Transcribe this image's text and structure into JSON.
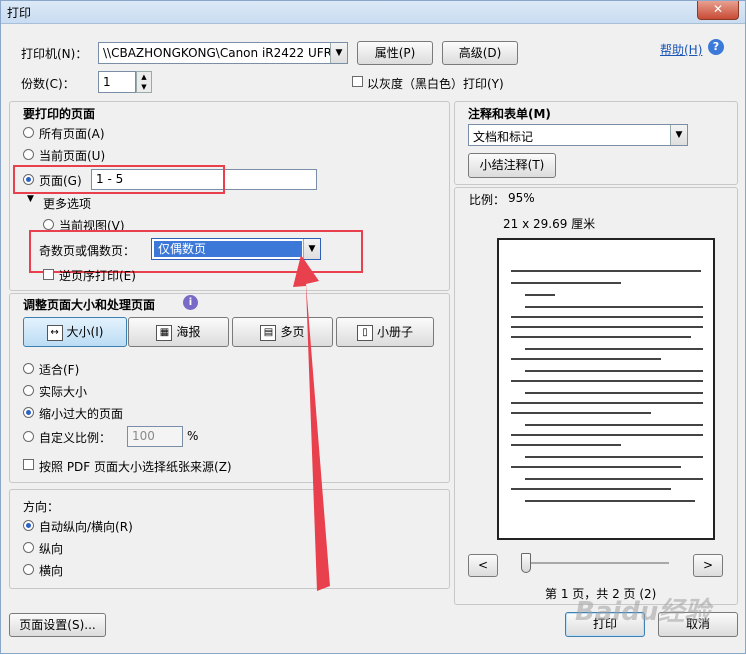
{
  "window": {
    "title": "打印",
    "close_glyph": "✕"
  },
  "printer": {
    "label": "打印机(N)：",
    "selected": "\\\\CBAZHONGKONG\\Canon iR2422 UFRII LT",
    "properties_button": "属性(P)",
    "advanced_button": "高级(D)",
    "help_link": "帮助(H)",
    "help_icon": "?"
  },
  "copies": {
    "label": "份数(C)：",
    "value": "1",
    "grayscale_label": "以灰度（黑白色）打印(Y)"
  },
  "pages_to_print": {
    "heading": "要打印的页面",
    "all_pages": "所有页面(A)",
    "current_page": "当前页面(U)",
    "pages": "页面(G)",
    "pages_value": "1 - 5",
    "more_options": "更多选项",
    "current_view": "当前视图(V)",
    "odd_even_label": "奇数页或偶数页：",
    "odd_even_selected": "仅偶数页",
    "reverse_order": "逆页序打印(E)"
  },
  "page_sizing": {
    "heading": "调整页面大小和处理页面",
    "info_icon": "i",
    "size_button": "大小(I)",
    "poster_button": "海报",
    "multiple_button": "多页",
    "booklet_button": "小册子",
    "fit": "适合(F)",
    "actual_size": "实际大小",
    "shrink_oversized": "缩小过大的页面",
    "custom_scale": "自定义比例：",
    "custom_scale_value": "100",
    "percent": "%",
    "choose_paper_source": "按照 PDF 页面大小选择纸张来源(Z)"
  },
  "orientation": {
    "heading": "方向：",
    "auto": "自动纵向/横向(R)",
    "portrait": "纵向",
    "landscape": "横向"
  },
  "comments": {
    "heading": "注释和表单(M)",
    "selected": "文档和标记",
    "summarize_button": "小结注释(T)"
  },
  "preview": {
    "scale_label": "比例：",
    "scale_value": "95%",
    "dimensions": "21 x 29.69 厘米",
    "prev_glyph": "<",
    "next_glyph": ">",
    "page_indicator": "第 1 页，共 2 页 (2)"
  },
  "footer": {
    "page_setup_button": "页面设置(S)...",
    "print_button": "打印",
    "cancel_button": "取消"
  },
  "watermark": "Baidu经验",
  "colors": {
    "annotation_red": "#e8404c",
    "accent_blue": "#2b62c6",
    "selection_blue": "#3c78d8"
  }
}
